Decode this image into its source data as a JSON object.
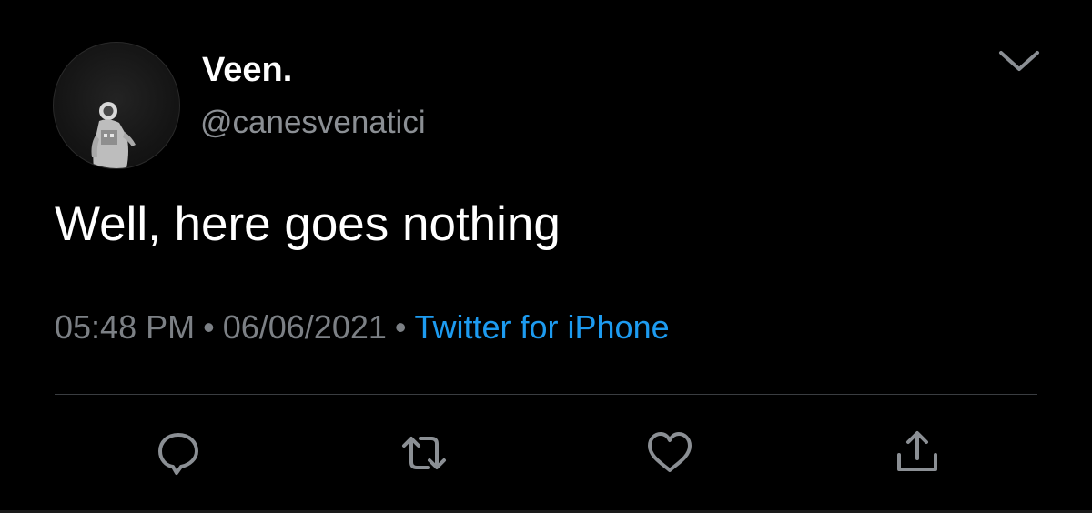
{
  "author": {
    "display_name": "Veen.",
    "handle": "@canesvenatici"
  },
  "tweet": {
    "text": "Well, here goes nothing"
  },
  "meta": {
    "time": "05:48 PM",
    "separator": "•",
    "date": "06/06/2021",
    "source": "Twitter for iPhone"
  },
  "icons": {
    "menu": "chevron-down-icon",
    "reply": "reply-icon",
    "retweet": "retweet-icon",
    "like": "heart-icon",
    "share": "share-icon"
  },
  "colors": {
    "background": "#000000",
    "text": "#ffffff",
    "secondary_text": "#8b8f94",
    "link": "#1d9bf0",
    "icon": "#8b8f94"
  }
}
